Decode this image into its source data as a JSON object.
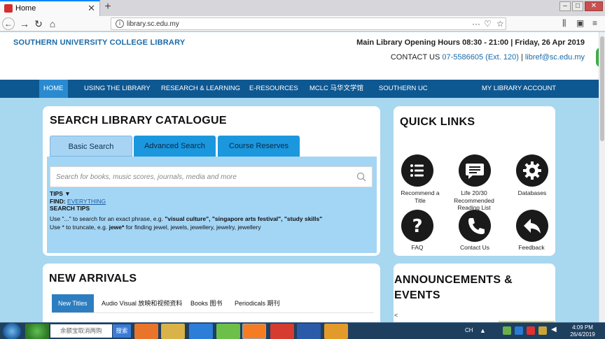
{
  "browser": {
    "tab_title": "Home",
    "url": "library.sc.edu.my",
    "tab_close": "✕",
    "new_tab": "+"
  },
  "header": {
    "logo": "SOUTHERN UNIVERSITY COLLEGE LIBRARY",
    "hours": "Main Library Opening Hours 08:30 - 21:00 | Friday, 26 Apr 2019",
    "contact_label": "CONTACT US",
    "phone": "07-5586605 (Ext. 120)",
    "separator": "|",
    "email": "libref@sc.edu.my"
  },
  "menu": {
    "items": [
      "HOME",
      "USING THE LIBRARY",
      "RESEARCH & LEARNING",
      "E-RESOURCES",
      "MCLC 马华文学馆",
      "SOUTHERN UC"
    ],
    "account": "MY LIBRARY ACCOUNT"
  },
  "search": {
    "title": "SEARCH LIBRARY CATALOGUE",
    "tabs": [
      "Basic Search",
      "Advanced Search",
      "Course Reserves"
    ],
    "placeholder": "Search for books, music scores, journals, media and more",
    "tips_label": "TIPS",
    "find_label": "FIND:",
    "find_value": "EVERYTHING",
    "search_tips_label": "SEARCH TIPS",
    "tip1_pre": "Use \"...\" to search for an exact phrase, e.g. ",
    "tip1_examples": "\"visual culture\", \"singapore arts festival\", \"study skills\"",
    "tip2_pre": "Use * to truncate, e.g. ",
    "tip2_term": "jewe*",
    "tip2_mid": " for finding ",
    "tip2_words": "jewel, jewels, jewellery, jewelry, jewellery"
  },
  "quick_links": {
    "title": "QUICK LINKS",
    "items": [
      {
        "label": "Recommend a Title",
        "icon": "list-icon"
      },
      {
        "label": "Life 20/30 Recommended Reading List",
        "icon": "chat-icon"
      },
      {
        "label": "Databases",
        "icon": "gear-icon"
      },
      {
        "label": "FAQ",
        "icon": "question-icon"
      },
      {
        "label": "Contact Us",
        "icon": "phone-icon"
      },
      {
        "label": "Feedback",
        "icon": "reply-icon"
      }
    ]
  },
  "new_arrivals": {
    "title": "NEW ARRIVALS",
    "tabs": [
      "New Titles",
      "Audio Visual 放映和视频资料",
      "Books 图书",
      "Periodicals 期刊"
    ]
  },
  "announcements": {
    "title": "ANNOUNCEMENTS & EVENTS",
    "prev": "<"
  },
  "taskbar": {
    "search_text": "余额宝取消两购",
    "search_btn": "搜索",
    "lang": "CH",
    "time": "4:09 PM",
    "date": "26/4/2019"
  }
}
